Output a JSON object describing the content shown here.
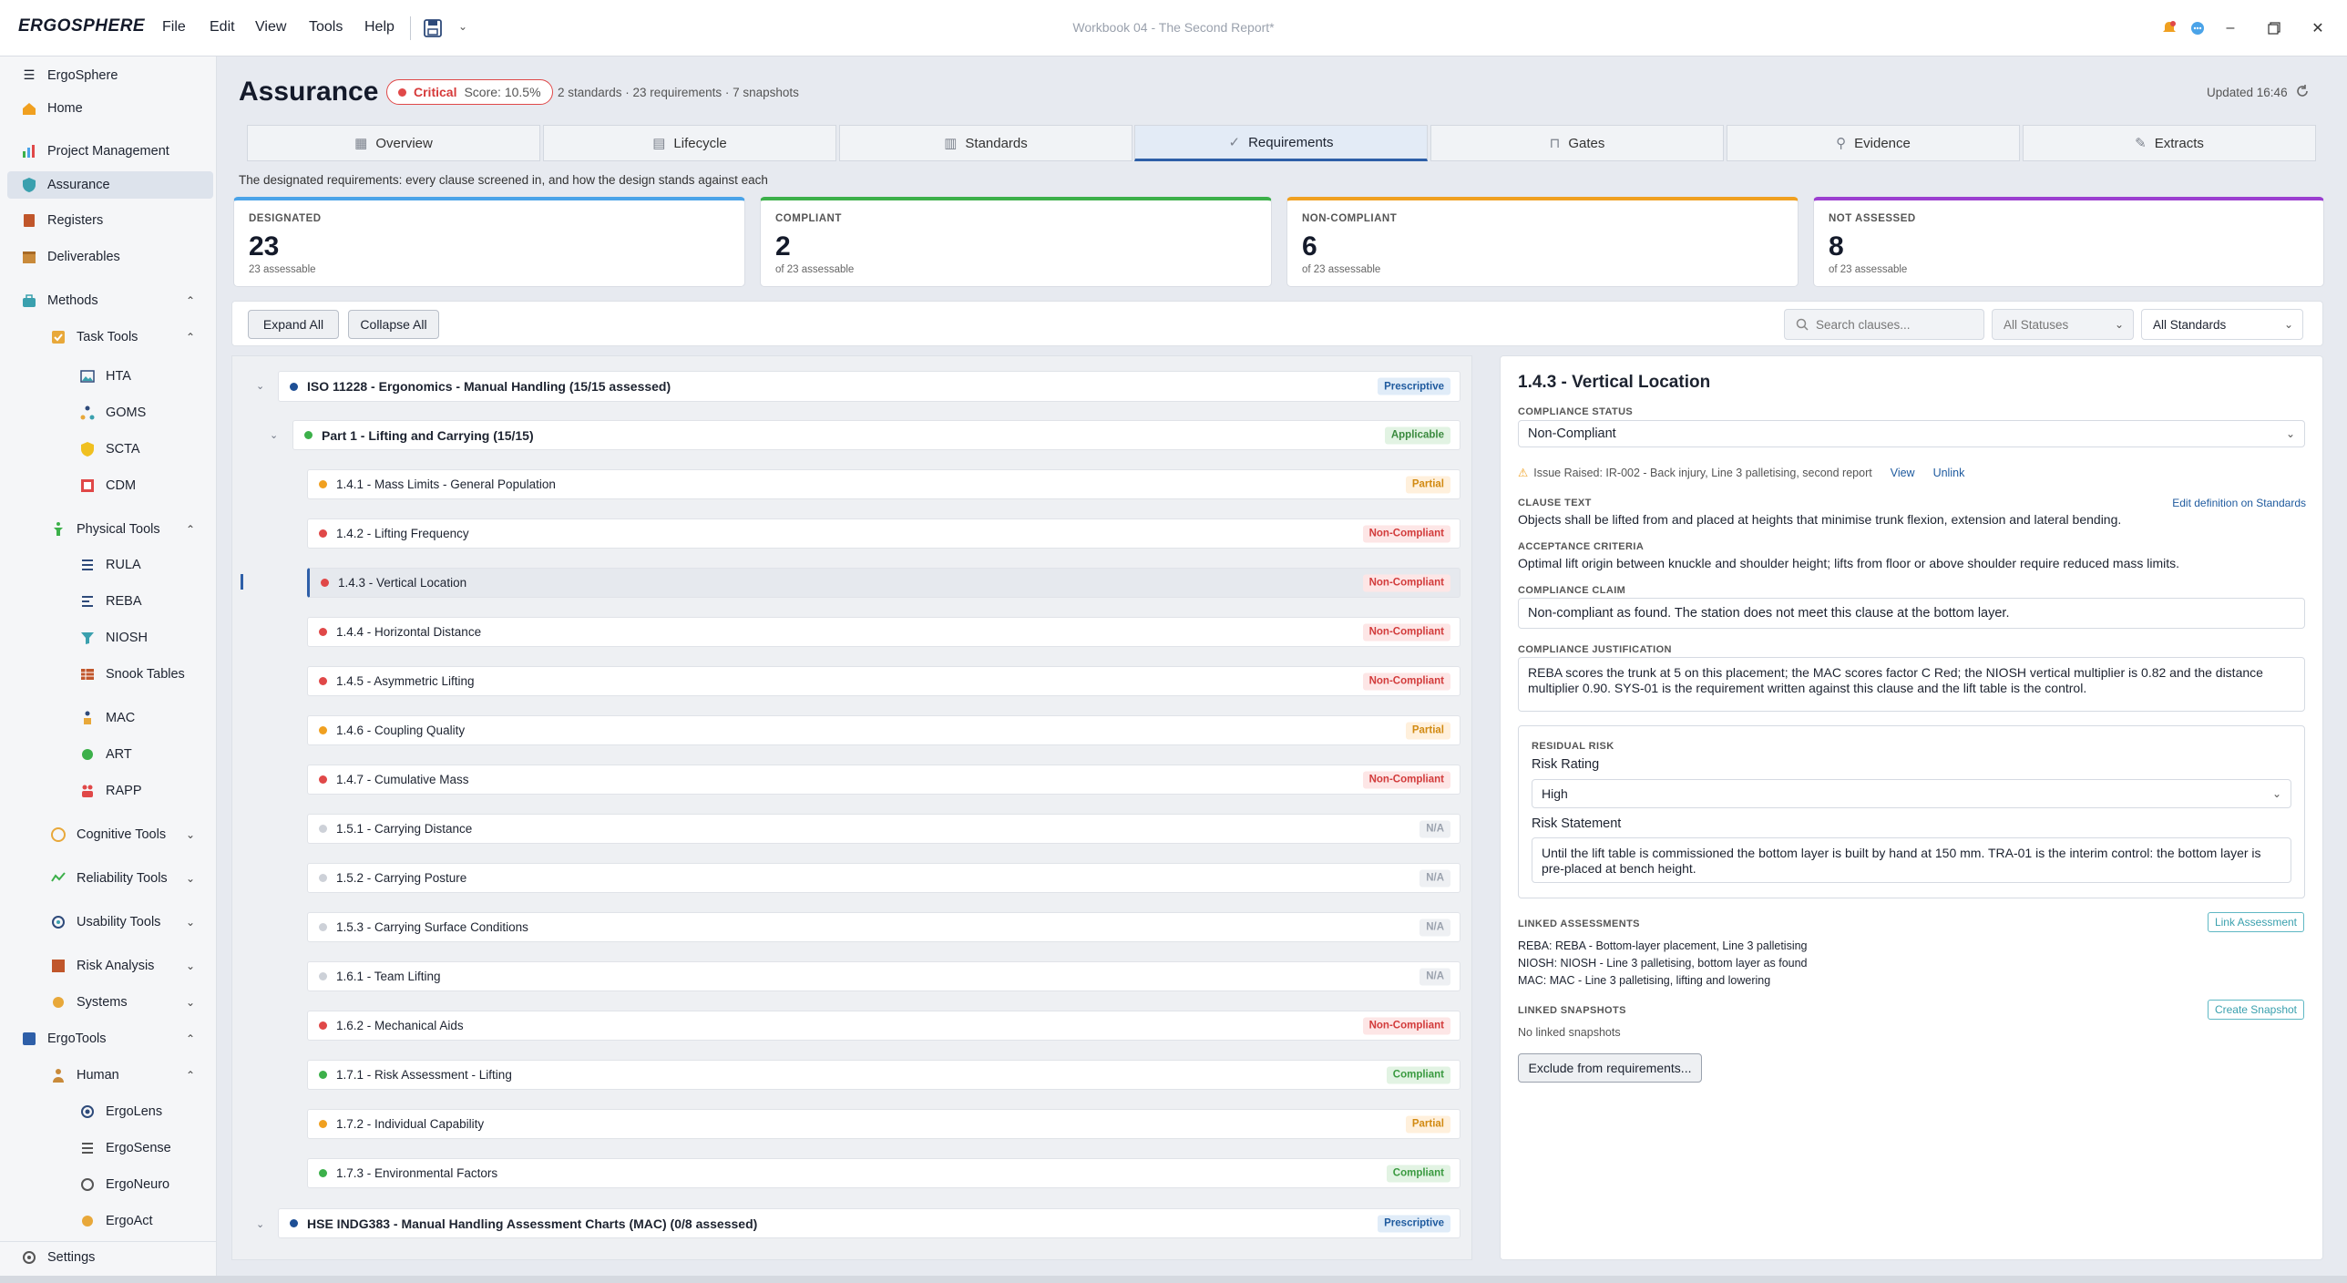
{
  "app": {
    "name": "ERGOSPHERE",
    "window_title": "Workbook 04 - The Second Report*"
  },
  "menu": [
    "File",
    "Edit",
    "View",
    "Tools",
    "Help"
  ],
  "sidebar": {
    "app_label": "ErgoSphere",
    "items": [
      "Home",
      "Project Management",
      "Assurance",
      "Registers",
      "Deliverables",
      "Methods",
      "Task Tools",
      "HTA",
      "GOMS",
      "SCTA",
      "CDM",
      "Physical Tools",
      "RULA",
      "REBA",
      "NIOSH",
      "Snook Tables",
      "MAC",
      "ART",
      "RAPP",
      "Cognitive Tools",
      "Reliability Tools",
      "Usability Tools",
      "Risk Analysis",
      "Systems",
      "ErgoTools",
      "Human",
      "ErgoLens",
      "ErgoSense",
      "ErgoNeuro",
      "ErgoAct"
    ],
    "settings": "Settings"
  },
  "header": {
    "title": "Assurance",
    "status_label": "Critical",
    "score": "Score: 10.5%",
    "summary": "2 standards · 23 requirements · 7 snapshots",
    "updated": "Updated 16:46"
  },
  "tabs": [
    "Overview",
    "Lifecycle",
    "Standards",
    "Requirements",
    "Gates",
    "Evidence",
    "Extracts"
  ],
  "caption": "The designated requirements: every clause screened in, and how the design stands against each",
  "cards": [
    {
      "label": "DESIGNATED",
      "value": "23",
      "sub": "23 assessable",
      "color": "#4aa3e8"
    },
    {
      "label": "COMPLIANT",
      "value": "2",
      "sub": "of 23 assessable",
      "color": "#3cb04a"
    },
    {
      "label": "NON-COMPLIANT",
      "value": "6",
      "sub": "of 23 assessable",
      "color": "#f0a020"
    },
    {
      "label": "NOT ASSESSED",
      "value": "8",
      "sub": "of 23 assessable",
      "color": "#9b3fd0"
    }
  ],
  "toolbar": {
    "expand": "Expand All",
    "collapse": "Collapse All",
    "search_placeholder": "Search clauses...",
    "status_filter": "All Statuses",
    "standard_filter": "All Standards"
  },
  "tree": {
    "standard1": {
      "title": "ISO 11228 - Ergonomics - Manual Handling  (15/15 assessed)",
      "badge": "Prescriptive"
    },
    "part1": {
      "title": "Part 1 - Lifting and Carrying  (15/15)",
      "badge": "Applicable"
    },
    "clauses": [
      {
        "label": "1.4.1 - Mass Limits - General Population",
        "status": "Partial"
      },
      {
        "label": "1.4.2 - Lifting Frequency",
        "status": "Non-Compliant"
      },
      {
        "label": "1.4.3 - Vertical Location",
        "status": "Non-Compliant"
      },
      {
        "label": "1.4.4 - Horizontal Distance",
        "status": "Non-Compliant"
      },
      {
        "label": "1.4.5 - Asymmetric Lifting",
        "status": "Non-Compliant"
      },
      {
        "label": "1.4.6 - Coupling Quality",
        "status": "Partial"
      },
      {
        "label": "1.4.7 - Cumulative Mass",
        "status": "Non-Compliant"
      },
      {
        "label": "1.5.1 - Carrying Distance",
        "status": "N/A"
      },
      {
        "label": "1.5.2 - Carrying Posture",
        "status": "N/A"
      },
      {
        "label": "1.5.3 - Carrying Surface Conditions",
        "status": "N/A"
      },
      {
        "label": "1.6.1 - Team Lifting",
        "status": "N/A"
      },
      {
        "label": "1.6.2 - Mechanical Aids",
        "status": "Non-Compliant"
      },
      {
        "label": "1.7.1 - Risk Assessment - Lifting",
        "status": "Compliant"
      },
      {
        "label": "1.7.2 - Individual Capability",
        "status": "Partial"
      },
      {
        "label": "1.7.3 - Environmental Factors",
        "status": "Compliant"
      }
    ],
    "standard2": {
      "title": "HSE INDG383 - Manual Handling Assessment Charts (MAC)  (0/8 assessed)",
      "badge": "Prescriptive"
    }
  },
  "detail": {
    "title": "1.4.3 - Vertical Location",
    "status_label": "COMPLIANCE STATUS",
    "status_value": "Non-Compliant",
    "issue_text": "Issue Raised: IR-002 - Back injury, Line 3 palletising, second report",
    "issue_view": "View",
    "issue_unlink": "Unlink",
    "clause_label": "CLAUSE TEXT",
    "edit_link": "Edit definition on Standards",
    "clause_text": "Objects shall be lifted from and placed at heights that minimise trunk flexion, extension and lateral bending.",
    "acceptance_label": "ACCEPTANCE CRITERIA",
    "acceptance_text": "Optimal lift origin between knuckle and shoulder height; lifts from floor or above shoulder require reduced mass limits.",
    "claim_label": "COMPLIANCE CLAIM",
    "claim_text": "Non-compliant as found. The station does not meet this clause at the bottom layer.",
    "justification_label": "COMPLIANCE JUSTIFICATION",
    "justification_text": "REBA scores the trunk at 5 on this placement; the MAC scores factor C Red; the NIOSH vertical multiplier is 0.82 and the distance multiplier 0.90. SYS-01 is the requirement written against this clause and the lift table is the control.",
    "residual_label": "RESIDUAL RISK",
    "risk_rating_label": "Risk Rating",
    "risk_rating_value": "High",
    "risk_statement_label": "Risk Statement",
    "risk_statement_text": "Until the lift table is commissioned the bottom layer is built by hand at 150 mm. TRA-01 is the interim control: the bottom layer is pre-placed at bench height.",
    "linked_assess_label": "LINKED ASSESSMENTS",
    "link_assessment_btn": "Link Assessment",
    "assessments": [
      "REBA: REBA - Bottom-layer placement, Line 3 palletising",
      "NIOSH: NIOSH - Line 3 palletising, bottom layer as found",
      "MAC: MAC - Line 3 palletising, lifting and lowering"
    ],
    "linked_snap_label": "LINKED SNAPSHOTS",
    "create_snapshot_btn": "Create Snapshot",
    "no_snapshots": "No linked snapshots",
    "exclude_btn": "Exclude from requirements..."
  }
}
